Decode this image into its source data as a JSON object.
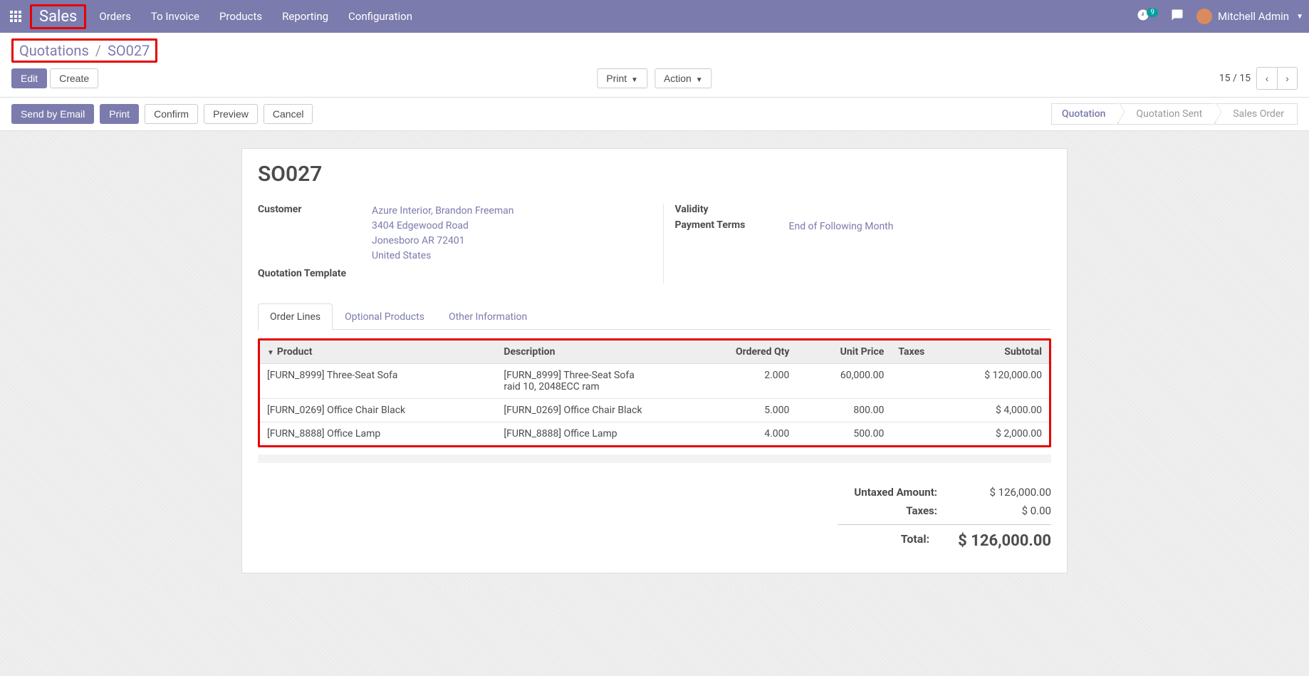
{
  "nav": {
    "brand": "Sales",
    "links": [
      "Orders",
      "To Invoice",
      "Products",
      "Reporting",
      "Configuration"
    ],
    "badge": "9",
    "user": "Mitchell Admin"
  },
  "breadcrumb": {
    "parent": "Quotations",
    "current": "SO027"
  },
  "buttons": {
    "edit": "Edit",
    "create": "Create",
    "print": "Print",
    "action": "Action",
    "send": "Send by Email",
    "print2": "Print",
    "confirm": "Confirm",
    "preview": "Preview",
    "cancel": "Cancel"
  },
  "pager": {
    "text": "15 / 15"
  },
  "status": {
    "steps": [
      "Quotation",
      "Quotation Sent",
      "Sales Order"
    ],
    "active": 0
  },
  "doc": {
    "title": "SO027",
    "customer_label": "Customer",
    "customer_name": "Azure Interior, Brandon Freeman",
    "customer_addr1": "3404 Edgewood Road",
    "customer_addr2": "Jonesboro AR 72401",
    "customer_country": "United States",
    "template_label": "Quotation Template",
    "validity_label": "Validity",
    "terms_label": "Payment Terms",
    "terms_value": "End of Following Month"
  },
  "tabs": [
    "Order Lines",
    "Optional Products",
    "Other Information"
  ],
  "table": {
    "headers": {
      "product": "Product",
      "desc": "Description",
      "qty": "Ordered Qty",
      "price": "Unit Price",
      "tax": "Taxes",
      "subtotal": "Subtotal"
    },
    "rows": [
      {
        "product": "[FURN_8999] Three-Seat Sofa",
        "desc": "[FURN_8999] Three-Seat Sofa",
        "desc2": "raid 10, 2048ECC ram",
        "qty": "2.000",
        "price": "60,000.00",
        "tax": "",
        "subtotal": "$ 120,000.00"
      },
      {
        "product": "[FURN_0269] Office Chair Black",
        "desc": "[FURN_0269] Office Chair Black",
        "desc2": "",
        "qty": "5.000",
        "price": "800.00",
        "tax": "",
        "subtotal": "$ 4,000.00"
      },
      {
        "product": "[FURN_8888] Office Lamp",
        "desc": "[FURN_8888] Office Lamp",
        "desc2": "",
        "qty": "4.000",
        "price": "500.00",
        "tax": "",
        "subtotal": "$ 2,000.00"
      }
    ]
  },
  "totals": {
    "untaxed_label": "Untaxed Amount:",
    "untaxed": "$ 126,000.00",
    "tax_label": "Taxes:",
    "tax": "$ 0.00",
    "total_label": "Total:",
    "total": "$ 126,000.00"
  }
}
